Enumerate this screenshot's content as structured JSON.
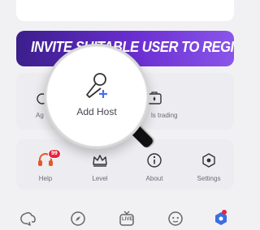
{
  "top_card": {
    "text": ""
  },
  "banner": {
    "text": "INVITE SUITABLE USER TO REGISTER"
  },
  "grid1": {
    "items": [
      {
        "label": "Ag",
        "icon": "agency-icon"
      },
      {
        "label": "ls trading",
        "icon": "trading-icon"
      }
    ]
  },
  "magnifier": {
    "label": "Add Host",
    "icon": "microphone-plus-icon"
  },
  "grid2": {
    "items": [
      {
        "label": "Help",
        "icon": "headset-icon",
        "badge": "99"
      },
      {
        "label": "Level",
        "icon": "crown-icon"
      },
      {
        "label": "About",
        "icon": "info-icon"
      },
      {
        "label": "Settings",
        "icon": "settings-icon"
      }
    ]
  },
  "nav": {
    "items": [
      {
        "name": "chat-icon"
      },
      {
        "name": "compass-icon"
      },
      {
        "name": "live-icon",
        "text": "LIVE"
      },
      {
        "name": "emoji-icon"
      },
      {
        "name": "profile-icon"
      }
    ],
    "active_color": "#3b6fe0",
    "badge_color": "#e8243b"
  },
  "colors": {
    "banner_start": "#3b1e8a",
    "banner_end": "#8a55ea",
    "help_icon": "#e8552b"
  }
}
